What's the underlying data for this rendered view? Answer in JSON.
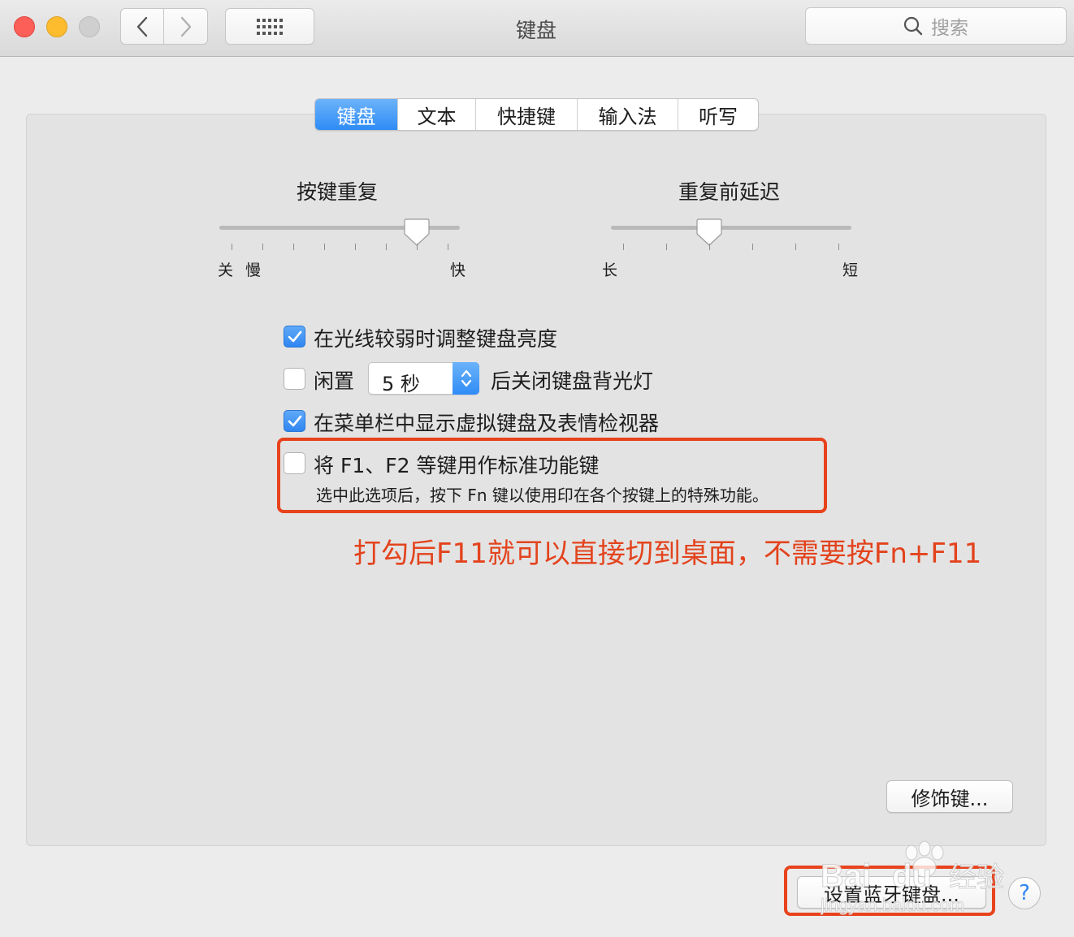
{
  "window": {
    "title": "键盘"
  },
  "search": {
    "placeholder": "搜索",
    "icon": "search-icon"
  },
  "tabs": [
    {
      "label": "键盘",
      "active": true
    },
    {
      "label": "文本",
      "active": false
    },
    {
      "label": "快捷键",
      "active": false
    },
    {
      "label": "输入法",
      "active": false
    },
    {
      "label": "听写",
      "active": false
    }
  ],
  "key_repeat": {
    "title": "按键重复",
    "min_labels": [
      "关",
      "慢"
    ],
    "max_label": "快",
    "level": 0.83
  },
  "repeat_delay": {
    "title": "重复前延迟",
    "min_label": "长",
    "max_label": "短",
    "level": 0.4
  },
  "options": {
    "adjust_brightness": {
      "label": "在光线较弱时调整键盘亮度",
      "checked": true
    },
    "idle_backlight": {
      "prefix": "闲置",
      "popup_value": "5 秒",
      "suffix": "后关闭键盘背光灯",
      "checked": false
    },
    "show_viewer": {
      "label": "在菜单栏中显示虚拟键盘及表情检视器",
      "checked": true
    },
    "fn_keys": {
      "label": "将 F1、F2 等键用作标准功能键",
      "hint": "选中此选项后，按下 Fn 键以使用印在各个按键上的特殊功能。",
      "checked": false
    }
  },
  "annotation": {
    "text": "打勾后F11就可以直接切到桌面，不需要按Fn+F11",
    "color": "#e3431d"
  },
  "buttons": {
    "modifier": "修饰键...",
    "bluetooth": "设置蓝牙键盘...",
    "help": "?"
  },
  "watermark": {
    "brand": "Bai",
    "suffix": "du",
    "cn": "经验",
    "url": "jingyan.baidu.com"
  },
  "colors": {
    "accent": "#2f8cf6",
    "annotation": "#e8431c"
  }
}
